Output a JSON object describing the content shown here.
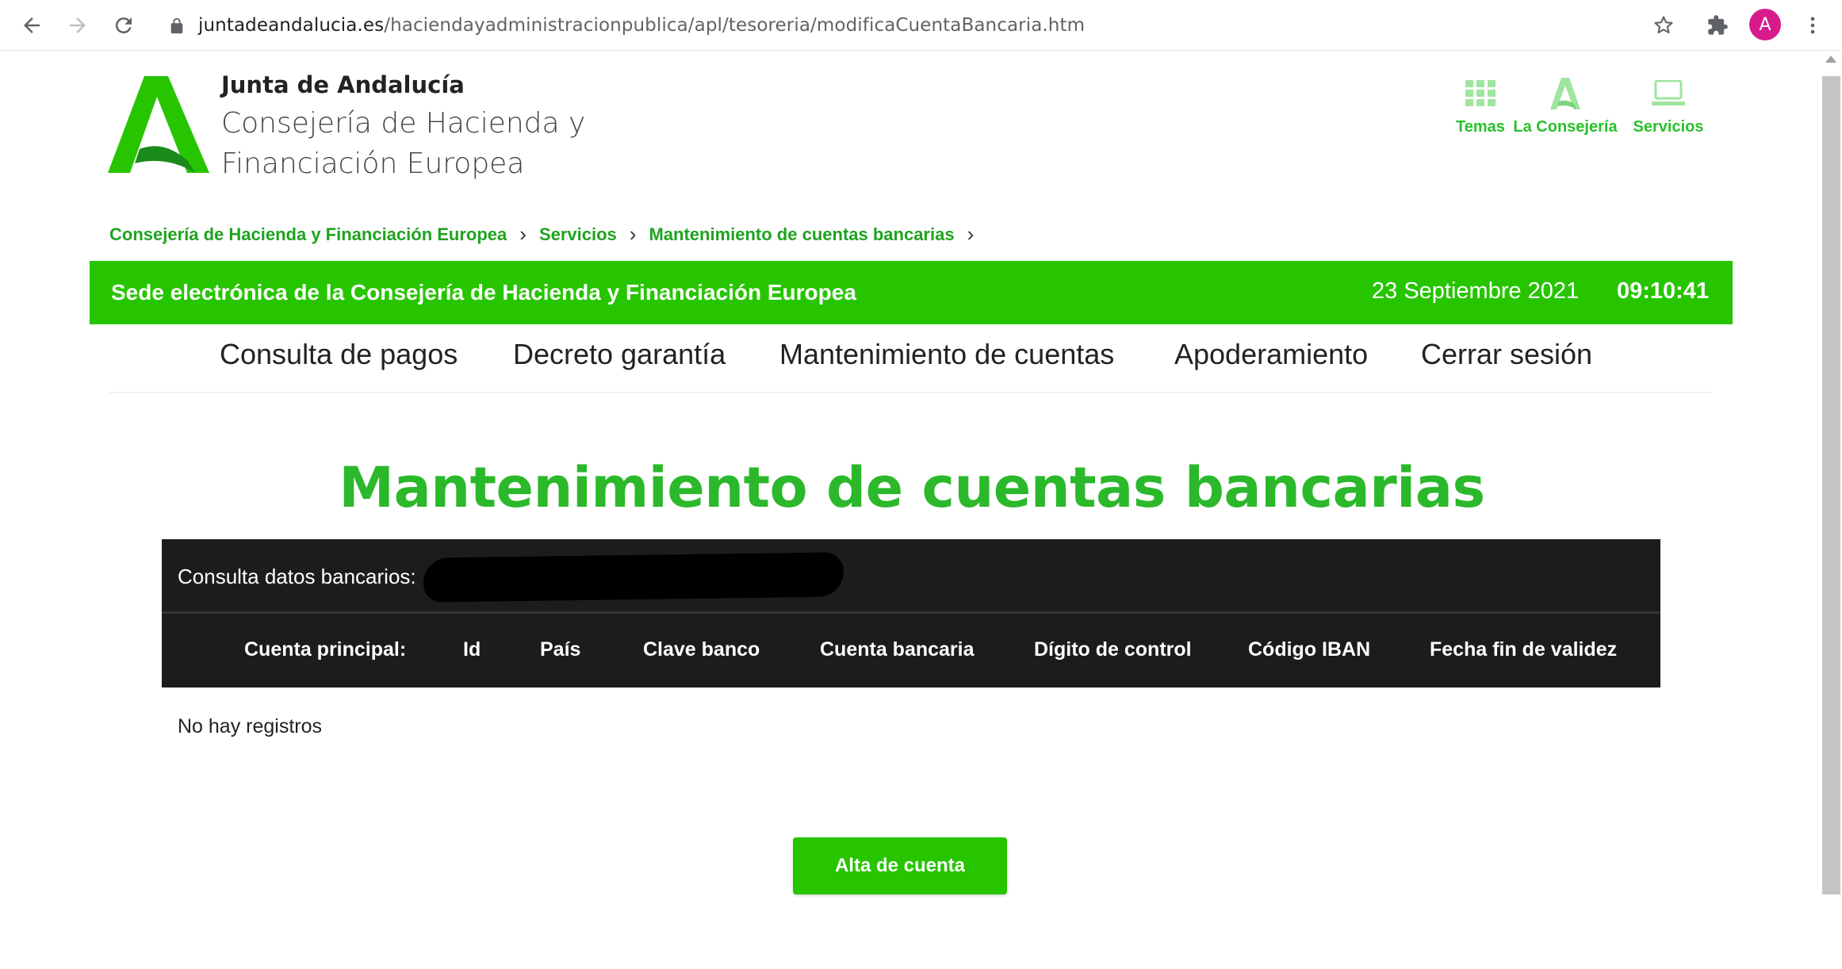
{
  "browser": {
    "url_host": "juntadeandalucia.es",
    "url_path": "/haciendayadministracionpublica/apl/tesoreria/modificaCuentaBancaria.htm",
    "avatar_letter": "A"
  },
  "header": {
    "brand_title": "Junta de Andalucía",
    "brand_subtitle": "Consejería de Hacienda y Financiación Europea",
    "links": [
      {
        "label": "Temas",
        "icon": "grid-icon"
      },
      {
        "label": "La Consejería",
        "icon": "andalucia-a-icon"
      },
      {
        "label": "Servicios",
        "icon": "laptop-icon"
      }
    ]
  },
  "breadcrumb": [
    "Consejería de Hacienda y Financiación Europea",
    "Servicios",
    "Mantenimiento de cuentas bancarias"
  ],
  "banner": {
    "title": "Sede electrónica de la Consejería de Hacienda y Financiación Europea",
    "date": "23 Septiembre 2021",
    "time": "09:10:41"
  },
  "menu": [
    "Consulta de pagos",
    "Decreto garantía",
    "Mantenimiento de cuentas",
    "Apoderamiento",
    "Cerrar sesión"
  ],
  "main": {
    "title": "Mantenimiento de cuentas bancarias",
    "table_caption": "Consulta datos bancarios:",
    "columns": [
      "Cuenta principal:",
      "Id",
      "País",
      "Clave banco",
      "Cuenta bancaria",
      "Dígito de control",
      "Código IBAN",
      "Fecha fin de validez"
    ],
    "empty_text": "No hay registros",
    "add_button": "Alta de cuenta"
  },
  "colors": {
    "accent_green": "#27c500",
    "link_green": "#1fa31f",
    "table_dark": "#1c1c1c"
  }
}
